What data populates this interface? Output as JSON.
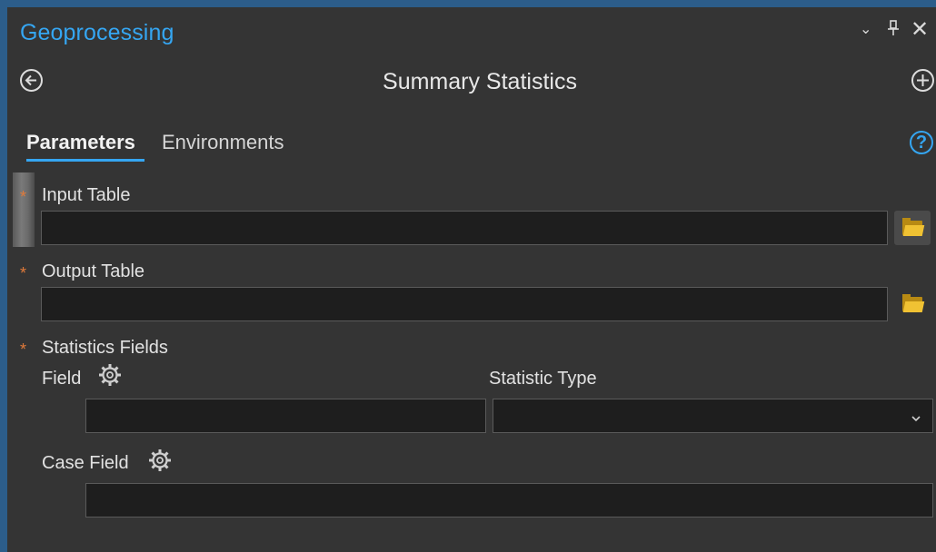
{
  "header": {
    "title": "Geoprocessing",
    "window_controls": {
      "collapse": "⌄",
      "pin": "⊥",
      "close": "✕"
    }
  },
  "tool": {
    "name": "Summary Statistics",
    "back_icon": "back-arrow-circle-icon",
    "add_icon": "add-circle-icon"
  },
  "tabs": {
    "parameters": "Parameters",
    "environments": "Environments",
    "help": "?"
  },
  "params": {
    "required_marker": "*",
    "input_table": {
      "label": "Input Table",
      "value": ""
    },
    "output_table": {
      "label": "Output Table",
      "value": ""
    },
    "statistics_fields": {
      "label": "Statistics Fields",
      "field_label": "Field",
      "statistic_type_label": "Statistic Type",
      "field_value": "",
      "statistic_type_value": ""
    },
    "case_field": {
      "label": "Case Field",
      "value": ""
    }
  },
  "colors": {
    "accent": "#35a6f2",
    "required": "#e07a3a",
    "panel_bg": "#343434",
    "input_bg": "#1e1e1e",
    "folder": "#f0c233"
  }
}
